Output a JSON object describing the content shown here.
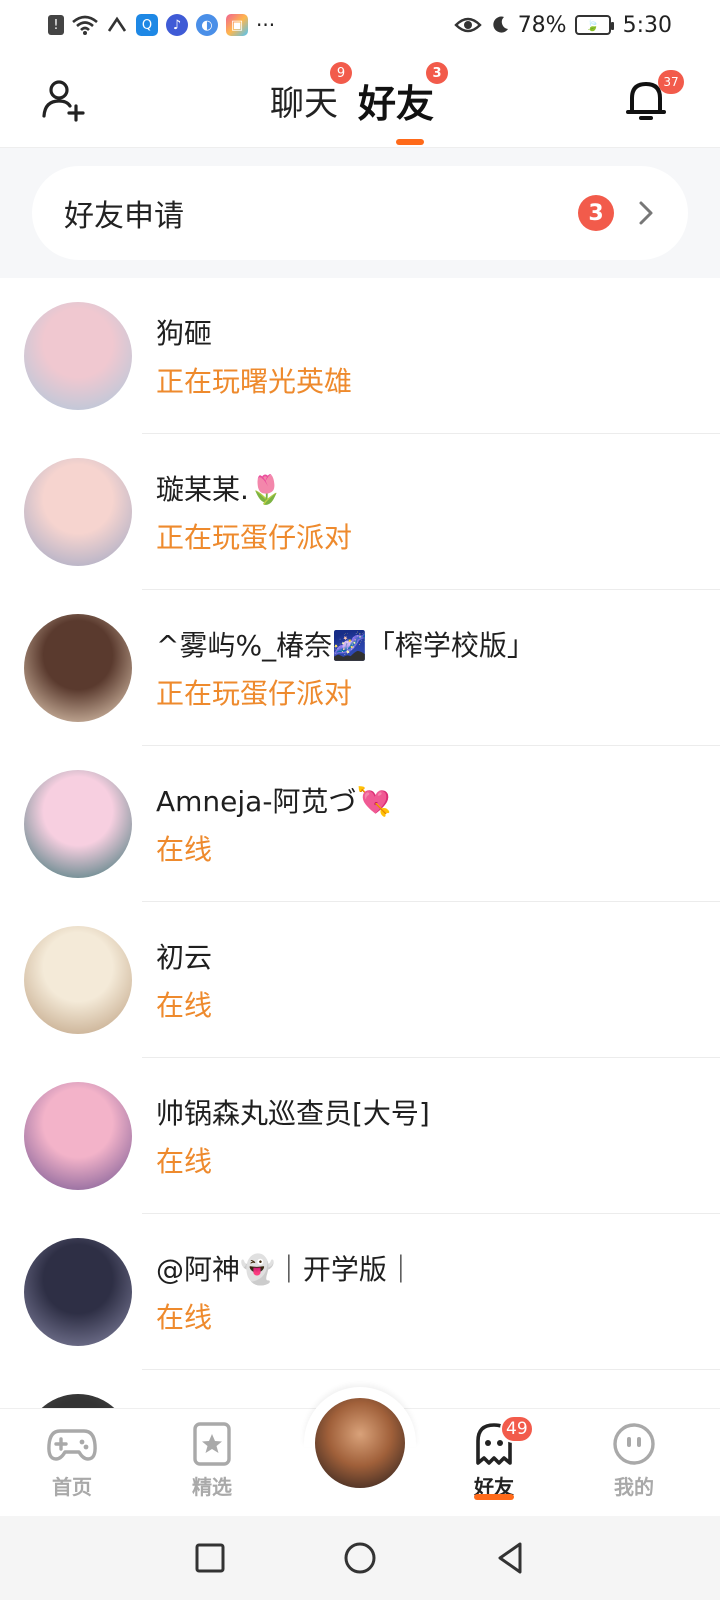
{
  "status_bar": {
    "battery": "78%",
    "time": "5:30",
    "more": "···"
  },
  "header": {
    "tabs": [
      {
        "label": "聊天",
        "badge": "9"
      },
      {
        "label": "好友",
        "badge": "3"
      }
    ],
    "bell_badge": "37"
  },
  "friend_request": {
    "label": "好友申请",
    "count": "3"
  },
  "friends": [
    {
      "name": "狗砸",
      "status": "正在玩曙光英雄",
      "avatar_colors": [
        "#f0c8d0",
        "#a9c7dc"
      ]
    },
    {
      "name": "璇某某.🌷",
      "status": "正在玩蛋仔派对",
      "avatar_colors": [
        "#f6d4cf",
        "#9aa5c4"
      ]
    },
    {
      "name": "^雾屿%_椿奈🌌「榨学校版」",
      "status": "正在玩蛋仔派对",
      "avatar_colors": [
        "#5a3a2e",
        "#f2dcc4"
      ]
    },
    {
      "name": "Amneja-阿苋づ💘",
      "status": "在线",
      "avatar_colors": [
        "#f7cfe0",
        "#2e6e6e"
      ]
    },
    {
      "name": "初云",
      "status": "在线",
      "avatar_colors": [
        "#f4ead8",
        "#b99a7a"
      ]
    },
    {
      "name": "帅锅森丸巡查员[大号]",
      "status": "在线",
      "avatar_colors": [
        "#f3b3c9",
        "#6b4f8e"
      ]
    },
    {
      "name": "@阿神👻｜开学版｜",
      "status": "在线",
      "avatar_colors": [
        "#2e2f45",
        "#8a8aa8"
      ]
    },
    {
      "name": "",
      "status": "",
      "avatar_colors": [
        "#333333",
        "#555555"
      ]
    }
  ],
  "bottom_nav": {
    "items": [
      {
        "label": "首页"
      },
      {
        "label": "精选"
      },
      {
        "label": "好友",
        "badge": "49"
      },
      {
        "label": "我的"
      }
    ]
  },
  "colors": {
    "accent": "#ff6a1a",
    "status_orange": "#ee8a2d",
    "badge_red": "#f25b4b"
  }
}
